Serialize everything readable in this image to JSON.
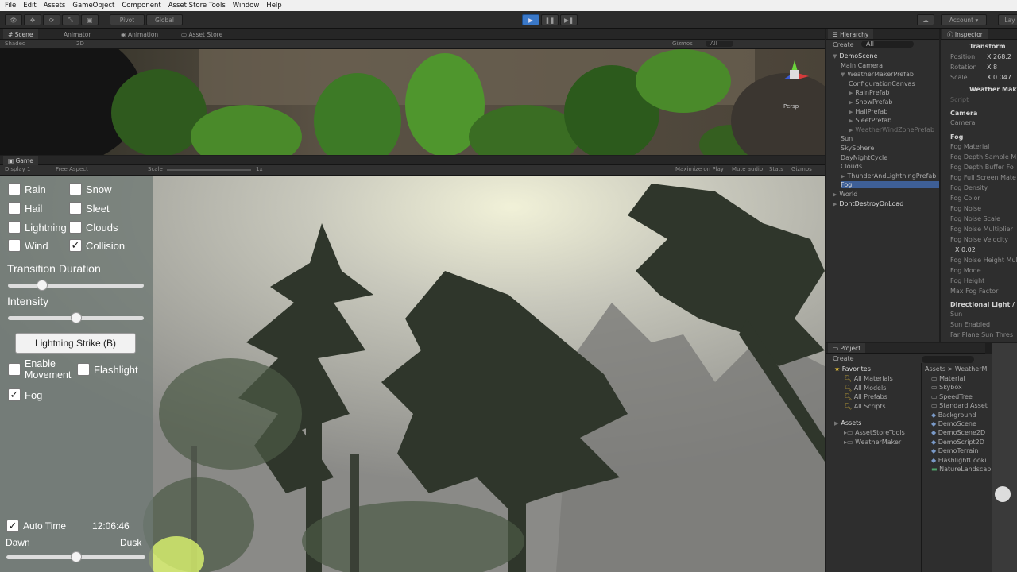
{
  "menu": [
    "File",
    "Edit",
    "Assets",
    "GameObject",
    "Component",
    "Asset Store Tools",
    "Window",
    "Help"
  ],
  "toolbar": {
    "pivot": "Pivot",
    "global": "Global",
    "account": "Account",
    "layers": "Lay"
  },
  "scene_tabs": {
    "scene": "Scene",
    "animator": "Animator",
    "animation": "Animation",
    "asset_store": "Asset Store"
  },
  "scene_bar": {
    "shading": "Shaded",
    "mode": "2D",
    "gizmos": "Gizmos",
    "search": "All"
  },
  "scene_persp": "Persp",
  "game_tab": "Game",
  "game_bar": {
    "display": "Display 1",
    "aspect": "Free Aspect",
    "scale_label": "Scale",
    "scale_value": "1x",
    "maximize": "Maximize on Play",
    "mute": "Mute audio",
    "stats": "Stats",
    "gizmos": "Gizmos"
  },
  "weather_ui": {
    "rain": "Rain",
    "snow": "Snow",
    "hail": "Hail",
    "sleet": "Sleet",
    "lightning": "Lightning",
    "clouds": "Clouds",
    "wind": "Wind",
    "collision": "Collision",
    "transition_label": "Transition Duration",
    "transition_value": 0.23,
    "intensity_label": "Intensity",
    "intensity_value": 0.5,
    "lightning_button": "Lightning Strike (B)",
    "enable_movement": "Enable Movement",
    "flashlight": "Flashlight",
    "fog": "Fog",
    "auto_time": "Auto Time",
    "time": "12:06:46",
    "dawn": "Dawn",
    "dusk": "Dusk",
    "time_value": 0.5
  },
  "checked": {
    "collision": true,
    "fog": true,
    "auto_time": true
  },
  "hierarchy": {
    "tab": "Hierarchy",
    "create": "Create",
    "search": "All",
    "items": [
      "DemoScene",
      "Main Camera",
      "WeatherMakerPrefab",
      "ConfigurationCanvas",
      "RainPrefab",
      "SnowPrefab",
      "HailPrefab",
      "SleetPrefab",
      "WeatherWindZonePrefab",
      "Sun",
      "SkySphere",
      "DayNightCycle",
      "Clouds",
      "ThunderAndLightningPrefab",
      "Fog",
      "World",
      "DontDestroyOnLoad"
    ]
  },
  "inspector": {
    "tab": "Inspector",
    "transform": "Transform",
    "position": "Position",
    "rotation": "Rotation",
    "scale": "Scale",
    "pos_x": "X 268.2",
    "rot_x": "X 8",
    "scale_x": "X 0.047",
    "component": "Weather Mak",
    "script": "Script",
    "camera_h": "Camera",
    "camera": "Camera",
    "fog_h": "Fog",
    "fog_props": [
      "Fog Material",
      "Fog Depth Sample M",
      "Fog Depth Buffer Fo",
      "Fog Full Screen Mate",
      "Fog Density",
      "Fog Color",
      "Fog Noise",
      "Fog Noise Scale",
      "Fog Noise Multiplier",
      "Fog Noise Velocity"
    ],
    "velocity_x": "X 0.02",
    "fog_props2": [
      "Fog Noise Height Mul",
      "Fog Mode",
      "Fog Height",
      "Max Fog Factor"
    ],
    "dir_light": "Directional Light /",
    "sun": "Sun",
    "sun_enabled": "Sun Enabled",
    "far_plane": "Far Plane Sun Thres"
  },
  "project": {
    "tab": "Project",
    "create": "Create",
    "favorites": "Favorites",
    "fav_items": [
      "All Materials",
      "All Models",
      "All Prefabs",
      "All Scripts"
    ],
    "assets": "Assets",
    "asset_items": [
      "AssetStoreTools",
      "WeatherMaker"
    ],
    "breadcrumb": "Assets > WeatherM",
    "files": [
      "Material",
      "Skybox",
      "SpeedTree",
      "Standard Asset",
      "Background",
      "DemoScene",
      "DemoScene2D",
      "DemoScript2D",
      "DemoTerrain",
      "FlashlightCooki",
      "NatureLandscap"
    ]
  },
  "colors": {
    "accent": "#3a78c8",
    "panel": "#2e2e2e",
    "selection": "#3e5f96"
  }
}
